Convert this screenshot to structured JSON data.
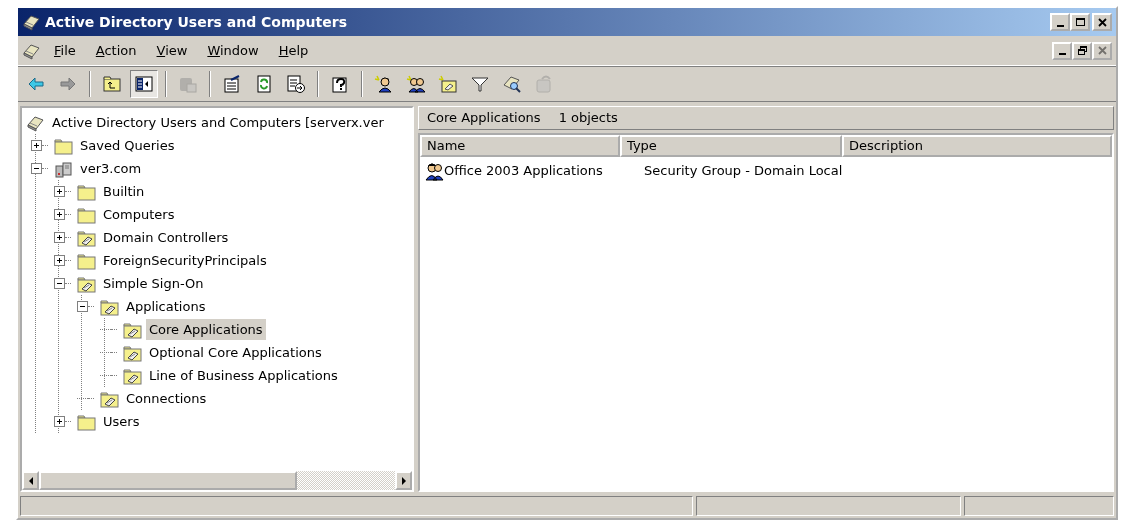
{
  "window": {
    "title": "Active Directory Users and Computers"
  },
  "title_buttons": [
    {
      "kind": "minimize",
      "disabled": false
    },
    {
      "kind": "maximize",
      "disabled": false
    },
    {
      "kind": "close",
      "disabled": false
    }
  ],
  "menu": [
    {
      "label": "File"
    },
    {
      "label": "Action"
    },
    {
      "label": "View"
    },
    {
      "label": "Window"
    },
    {
      "label": "Help"
    }
  ],
  "mdi_buttons": [
    {
      "kind": "minimize",
      "disabled": false
    },
    {
      "kind": "restore",
      "disabled": false
    },
    {
      "kind": "close",
      "disabled": true
    }
  ],
  "toolbar_groups": [
    [
      {
        "disabled": false,
        "pressed": false
      },
      {
        "disabled": false,
        "pressed": false
      }
    ],
    [
      {
        "disabled": false,
        "pressed": false
      },
      {
        "disabled": false,
        "pressed": true
      }
    ],
    [
      {
        "disabled": true,
        "pressed": false
      }
    ],
    [
      {
        "disabled": false,
        "pressed": false
      },
      {
        "disabled": false,
        "pressed": false
      },
      {
        "disabled": false,
        "pressed": false
      }
    ],
    [
      {
        "disabled": false,
        "pressed": false
      }
    ],
    [
      {
        "disabled": false,
        "pressed": false
      },
      {
        "disabled": false,
        "pressed": false
      },
      {
        "disabled": false,
        "pressed": false
      },
      {
        "disabled": false,
        "pressed": false
      },
      {
        "disabled": false,
        "pressed": false
      },
      {
        "disabled": true,
        "pressed": false
      }
    ]
  ],
  "tree": {
    "label": "Active Directory Users and Computers [serverx.ver",
    "kind": "root",
    "selected": false,
    "children": [
      {
        "label": "Saved Queries",
        "kind": "folder",
        "expandable": true,
        "expanded": false,
        "selected": false
      },
      {
        "label": "ver3.com",
        "kind": "domain",
        "expandable": true,
        "expanded": true,
        "selected": false,
        "children": [
          {
            "label": "Builtin",
            "kind": "folder",
            "expandable": true,
            "expanded": false,
            "selected": false
          },
          {
            "label": "Computers",
            "kind": "folder",
            "expandable": true,
            "expanded": false,
            "selected": false
          },
          {
            "label": "Domain Controllers",
            "kind": "ou",
            "expandable": true,
            "expanded": false,
            "selected": false
          },
          {
            "label": "ForeignSecurityPrincipals",
            "kind": "folder",
            "expandable": true,
            "expanded": false,
            "selected": false
          },
          {
            "label": "Simple Sign-On",
            "kind": "ou",
            "expandable": true,
            "expanded": true,
            "selected": false,
            "children": [
              {
                "label": "Applications",
                "kind": "ou",
                "expandable": true,
                "expanded": true,
                "selected": false,
                "children": [
                  {
                    "label": "Core Applications",
                    "kind": "ou",
                    "expandable": false,
                    "selected": true
                  },
                  {
                    "label": "Optional Core Applications",
                    "kind": "ou",
                    "expandable": false,
                    "selected": false
                  },
                  {
                    "label": "Line of Business Applications",
                    "kind": "ou",
                    "expandable": false,
                    "selected": false
                  }
                ]
              },
              {
                "label": "Connections",
                "kind": "ou",
                "expandable": false,
                "selected": false
              }
            ]
          },
          {
            "label": "Users",
            "kind": "folder",
            "expandable": true,
            "expanded": false,
            "selected": false
          }
        ]
      }
    ]
  },
  "details": {
    "title": "Core Applications",
    "count": "1 objects",
    "columns": [
      "Name",
      "Type",
      "Description"
    ],
    "rows": [
      {
        "kind": "group",
        "name": "Office 2003 Applications",
        "type": "Security Group - Domain Local"
      }
    ]
  }
}
